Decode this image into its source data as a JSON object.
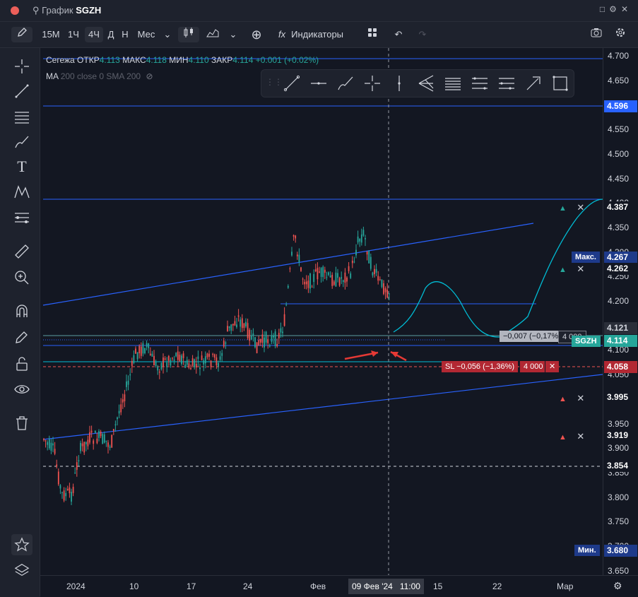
{
  "titlebar": {
    "label": "График",
    "symbol": "SGZH"
  },
  "toolbar": {
    "intervals": [
      "15М",
      "1Ч",
      "4Ч",
      "Д",
      "Н",
      "Мес"
    ],
    "active_interval": "4Ч",
    "indicators_label": "Индикаторы"
  },
  "legend": {
    "name": "Сегежа",
    "open_label": "ОТКР",
    "open": "4.113",
    "high_label": "МАКС",
    "high": "4.118",
    "low_label": "МИН",
    "low": "4.110",
    "close_label": "ЗАКР",
    "close": "4.114",
    "change": "+0.001 (+0.02%)",
    "ma_label": "MA",
    "ma_params": "200 close 0 SMA 200"
  },
  "price_axis": {
    "ticks": [
      "4.700",
      "4.650",
      "4.600",
      "4.550",
      "4.500",
      "4.450",
      "4.400",
      "4.350",
      "4.300",
      "4.250",
      "4.200",
      "4.150",
      "4.100",
      "4.050",
      "4.000",
      "3.950",
      "3.900",
      "3.850",
      "3.800",
      "3.750",
      "3.700",
      "3.650"
    ],
    "labels": {
      "level_4596": "4.596",
      "level_4387": "4.387",
      "max_tag": "Макс.",
      "max_value": "4.267",
      "level_4262": "4.262",
      "level_4121": "4.121",
      "symbol_tag": "SGZH",
      "last_price": "4.114",
      "stop_price": "4.058",
      "level_3995": "3.995",
      "level_3919": "3.919",
      "level_3854": "3.854",
      "min_tag": "Мин.",
      "min_value": "3.680"
    }
  },
  "time_axis": {
    "ticks": [
      "2024",
      "10",
      "17",
      "24",
      "Фев",
      "15",
      "22",
      "Мар"
    ],
    "crosshair_date": "09 Фев '24",
    "crosshair_time": "11:00"
  },
  "orders": {
    "position_label": "−0,007 (−0,17%)",
    "position_qty": "4 000",
    "sl_label": "SL −0,056 (−1,36%)",
    "sl_qty": "4 000"
  },
  "colors": {
    "up": "#26a69a",
    "down": "#ef5350",
    "line": "#2962ff",
    "cyan": "#00bcd4",
    "accent": "#2962ff"
  }
}
